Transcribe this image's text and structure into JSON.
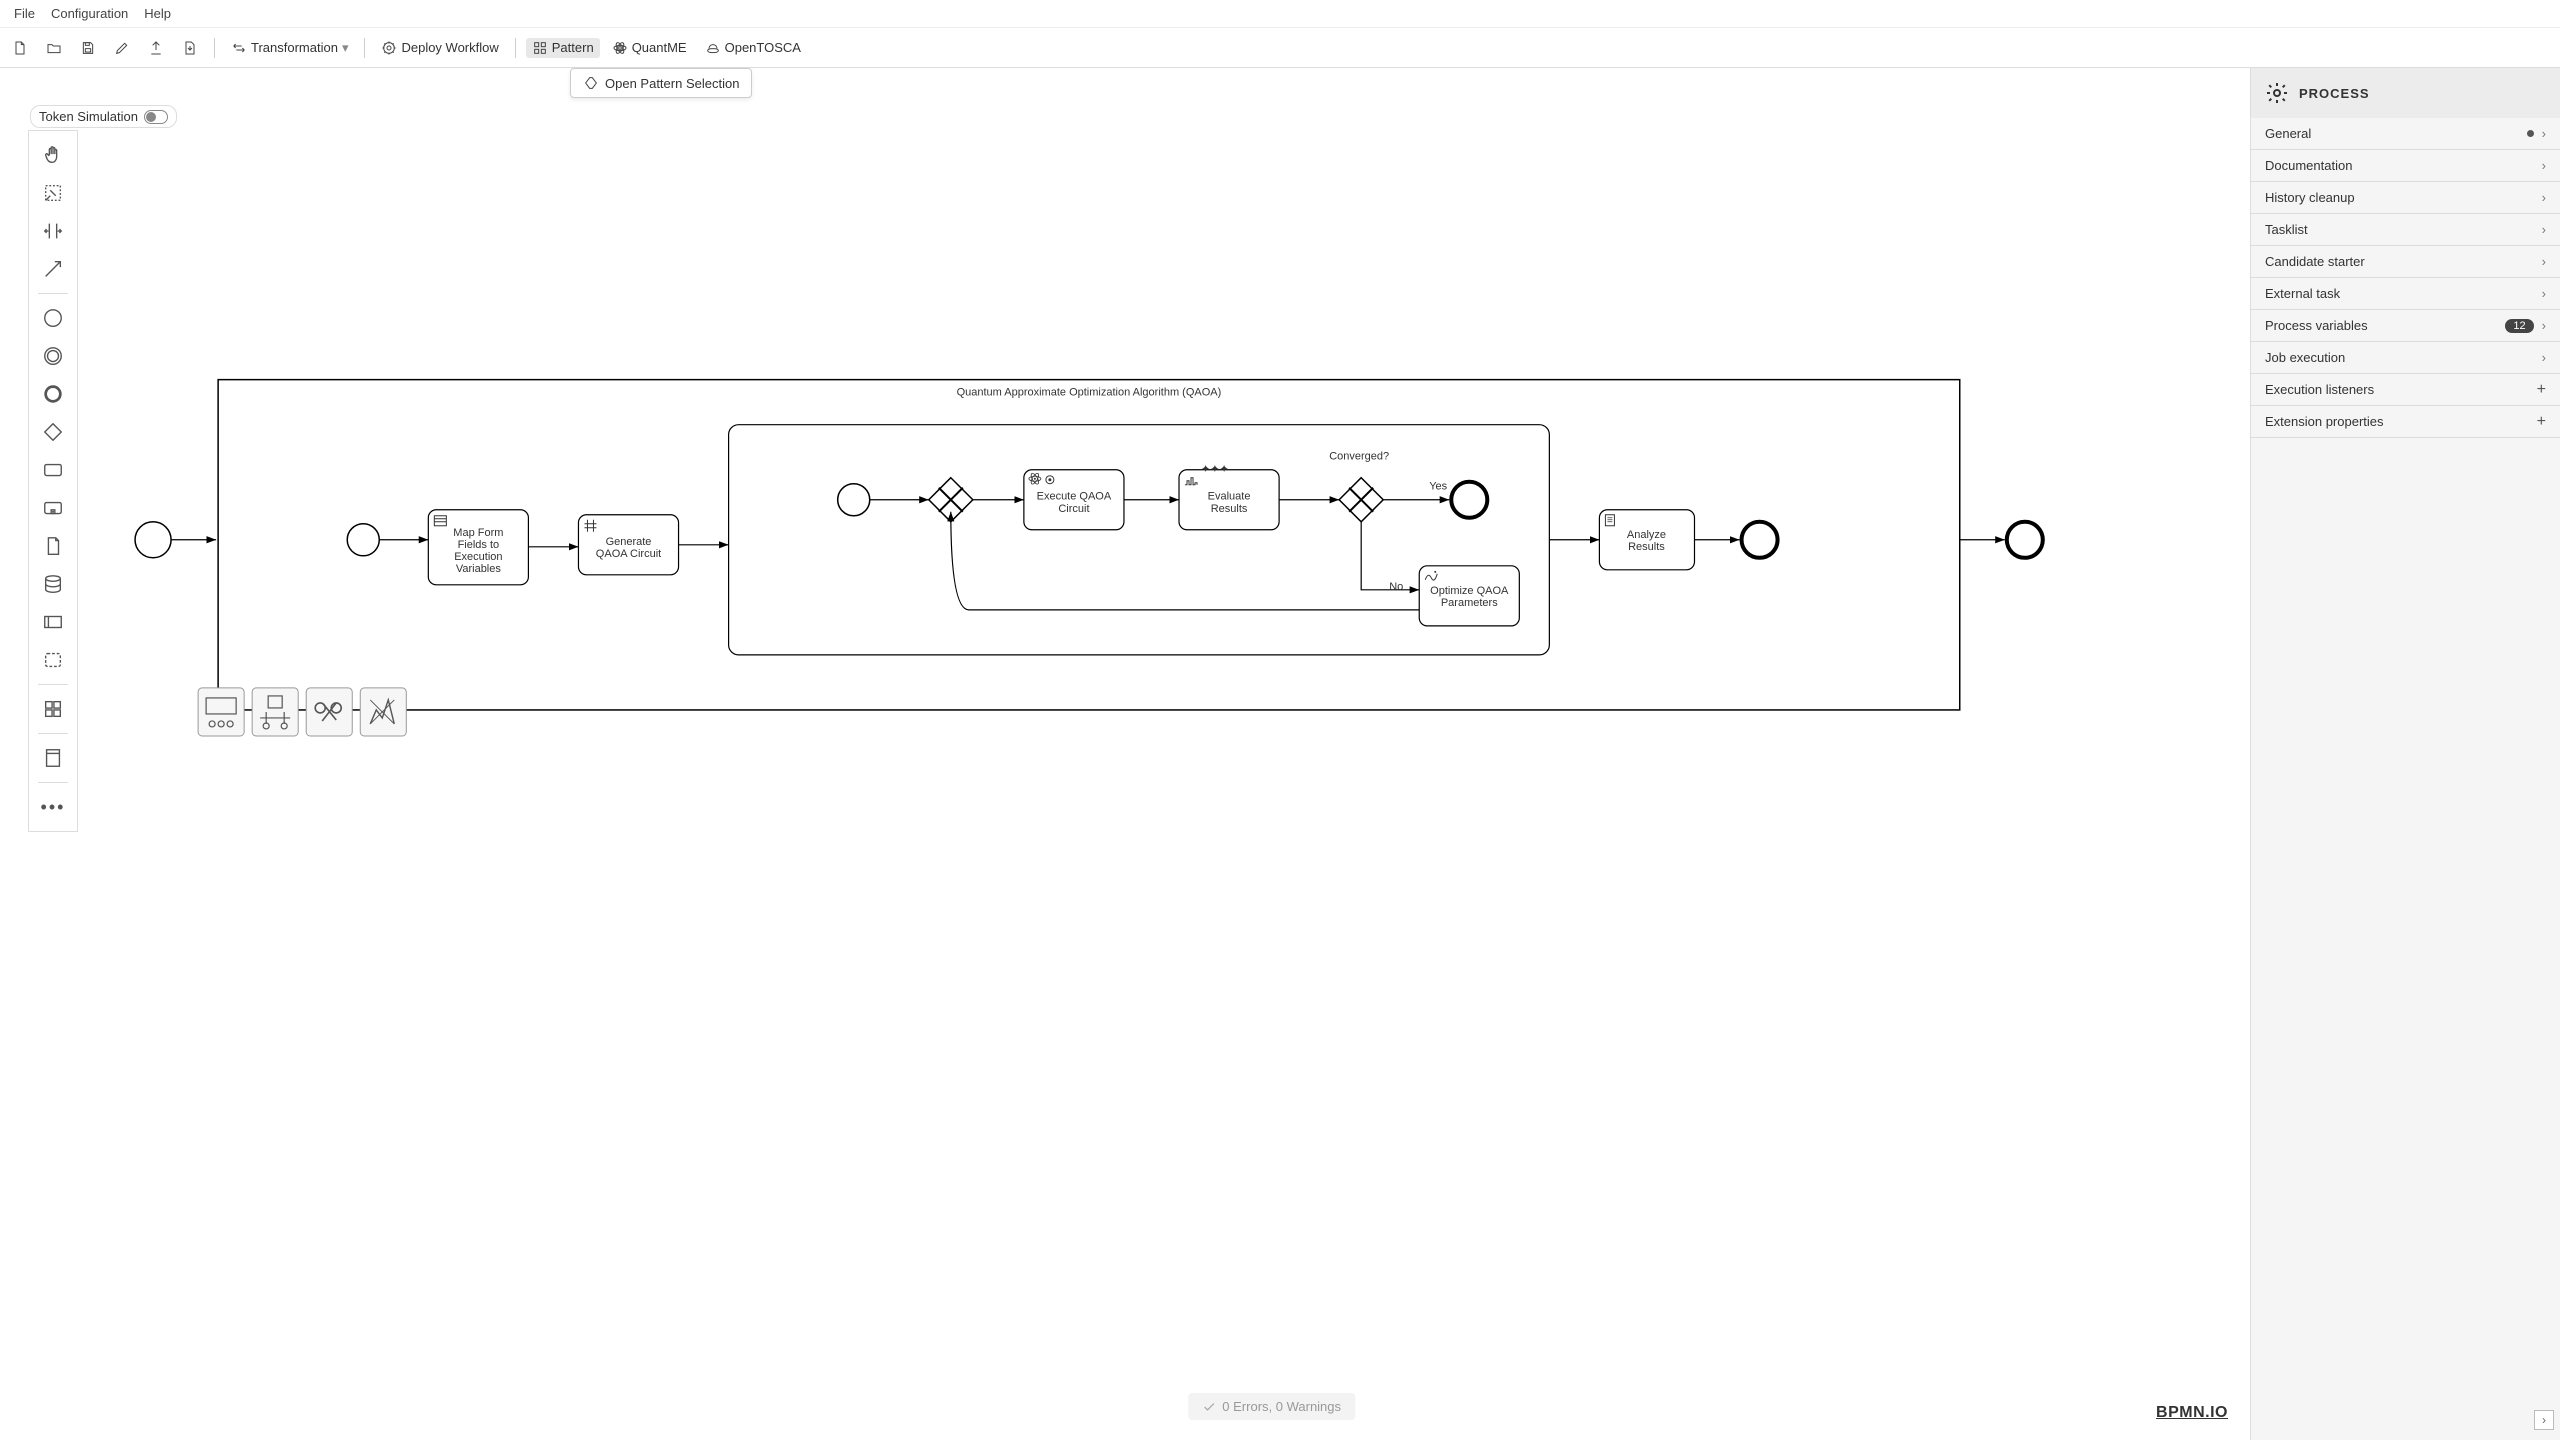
{
  "menu": {
    "file": "File",
    "configuration": "Configuration",
    "help": "Help"
  },
  "toolbar": {
    "transformation": "Transformation",
    "deploy": "Deploy Workflow",
    "pattern": "Pattern",
    "quantme": "QuantME",
    "opentosca": "OpenTOSCA",
    "open_pattern_selection": "Open Pattern Selection"
  },
  "token_sim": "Token Simulation",
  "diagram": {
    "process_title": "Quantum Approximate Optimization Algorithm (QAOA)",
    "tasks": {
      "map_form": "Map Form Fields to Execution Variables",
      "gen_circuit": "Generate QAOA Circuit",
      "exec_circuit": "Execute QAOA Circuit",
      "eval_results": "Evaluate Results",
      "optimize_params": "Optimize QAOA Parameters",
      "analyze": "Analyze Results"
    },
    "labels": {
      "converged_q": "Converged?",
      "yes": "Yes",
      "no": "No"
    }
  },
  "props": {
    "header": "PROCESS",
    "rows": [
      {
        "label": "General",
        "dot": true,
        "chev": true
      },
      {
        "label": "Documentation",
        "chev": true
      },
      {
        "label": "History cleanup",
        "chev": true
      },
      {
        "label": "Tasklist",
        "chev": true
      },
      {
        "label": "Candidate starter",
        "chev": true
      },
      {
        "label": "External task",
        "chev": true
      },
      {
        "label": "Process variables",
        "count": "12",
        "chev": true
      },
      {
        "label": "Job execution",
        "chev": true
      },
      {
        "label": "Execution listeners",
        "plus": true
      },
      {
        "label": "Extension properties",
        "plus": true
      }
    ]
  },
  "status": "0 Errors, 0 Warnings",
  "logo": "BPMN.IO"
}
